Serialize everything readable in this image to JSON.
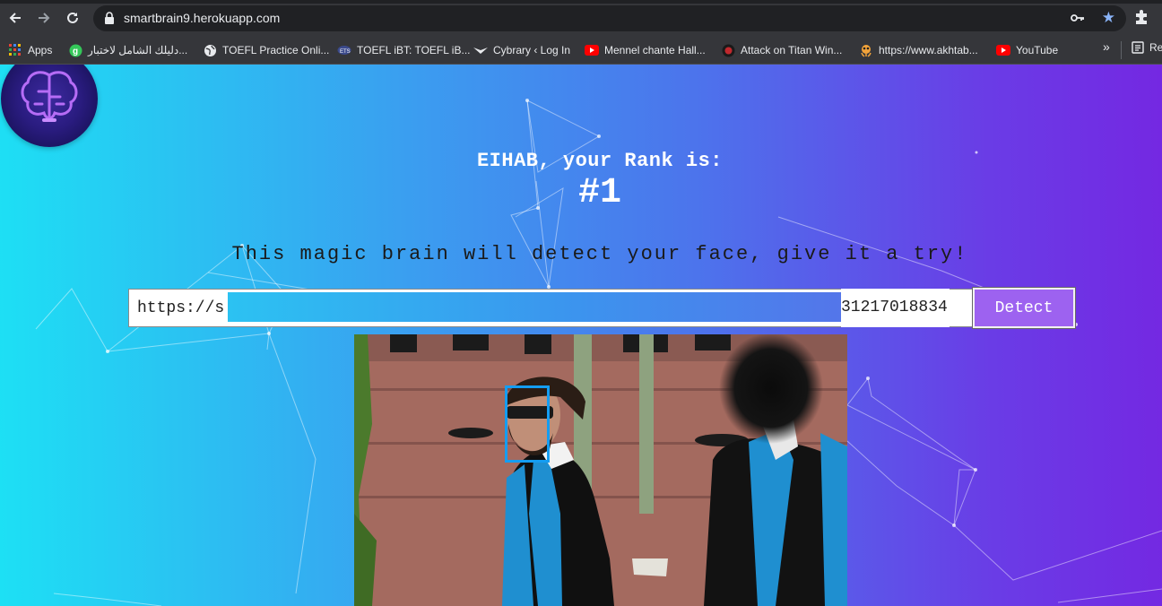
{
  "browser": {
    "url": "smartbrain9.herokuapp.com",
    "bookmarks": [
      {
        "label": "Apps",
        "icon": "apps-grid-icon"
      },
      {
        "label": "دليلك الشامل لاختبار...",
        "icon": "g-site-icon"
      },
      {
        "label": "TOEFL Practice Onli...",
        "icon": "globe-icon"
      },
      {
        "label": "TOEFL iBT: TOEFL iB...",
        "icon": "ets-icon"
      },
      {
        "label": "Cybrary ‹ Log In",
        "icon": "cybrary-icon"
      },
      {
        "label": "Mennel chante Hall...",
        "icon": "youtube-icon"
      },
      {
        "label": "Attack on Titan Win...",
        "icon": "aot-icon"
      },
      {
        "label": "https://www.akhtab...",
        "icon": "akhtaboot-icon"
      },
      {
        "label": "YouTube",
        "icon": "youtube-icon"
      }
    ],
    "more_label": "»",
    "reading_list_label": "Re"
  },
  "page": {
    "rank_line": "EIHAB, your Rank is:",
    "rank_value": "#1",
    "tagline": "This magic brain will detect your face, give it a try!",
    "input_value": "https://s",
    "input_tail": "31217018834",
    "detect_label": "Detect"
  },
  "colors": {
    "gradient_start": "#1de0f4",
    "gradient_end": "#7428e2",
    "detect_button": "#9d62f0",
    "face_box": "#149df2"
  }
}
